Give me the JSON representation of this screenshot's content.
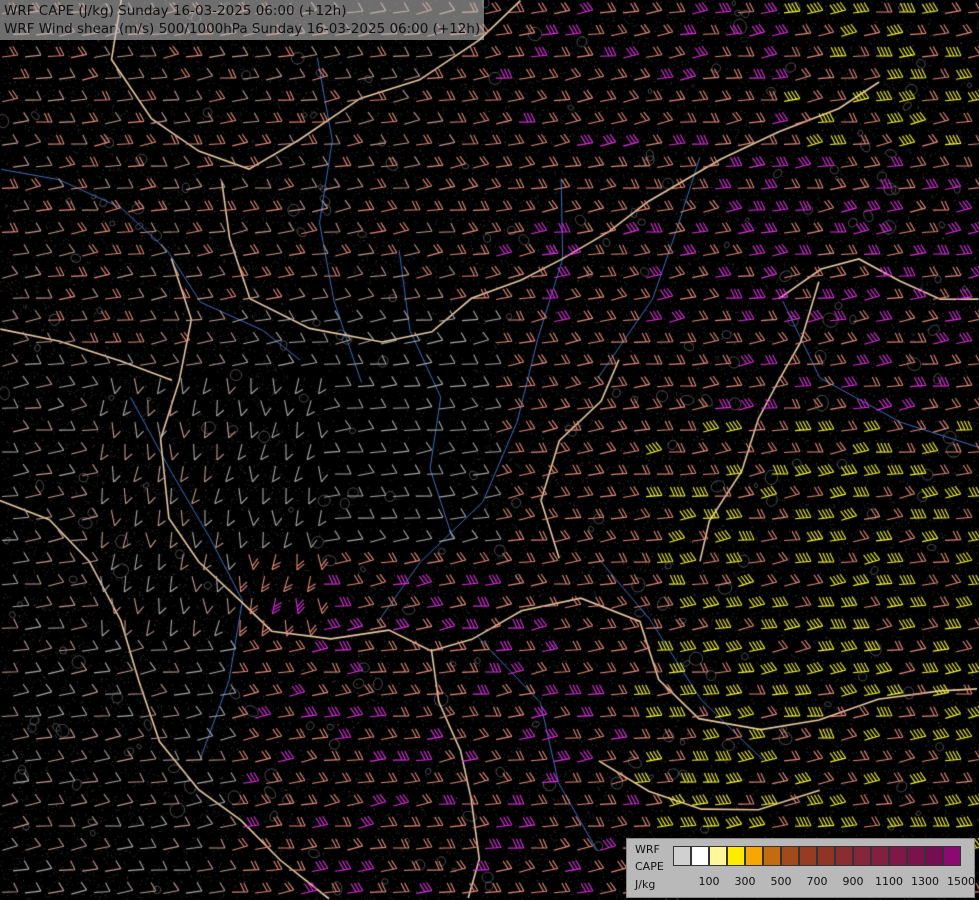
{
  "title": {
    "line1": "WRF CAPE (J/kg) Sunday 16-03-2025 06:00 (+12h)",
    "line2": "WRF Wind shear (m/s) 500/1000hPa Sunday 16-03-2025 06:00 (+12h)"
  },
  "legend": {
    "name_lines": [
      "WRF",
      "CAPE",
      "J/kg"
    ],
    "colors": [
      "#d0d0d0",
      "#ffffff",
      "#fff79a",
      "#ffeb00",
      "#f7a600",
      "#c46a10",
      "#a24a1c",
      "#963c20",
      "#8e3526",
      "#8a2c30",
      "#86263a",
      "#822040",
      "#7e1846",
      "#7a124c",
      "#760c52",
      "#8c0a70"
    ],
    "ticks": [
      {
        "label": "100",
        "index": 2
      },
      {
        "label": "300",
        "index": 4
      },
      {
        "label": "500",
        "index": 6
      },
      {
        "label": "700",
        "index": 8
      },
      {
        "label": "900",
        "index": 10
      },
      {
        "label": "1100",
        "index": 12
      },
      {
        "label": "1300",
        "index": 14
      },
      {
        "label": "1500",
        "index": 16
      }
    ]
  },
  "shear_colors": {
    "weak": "#a9a9a9",
    "light": "#c09a90",
    "moderate": "#e28a7a",
    "strong": "#e02ee0",
    "extreme": "#f3f32a"
  },
  "border_color": "#e8c9a0",
  "river_color": "#3c6fbf"
}
